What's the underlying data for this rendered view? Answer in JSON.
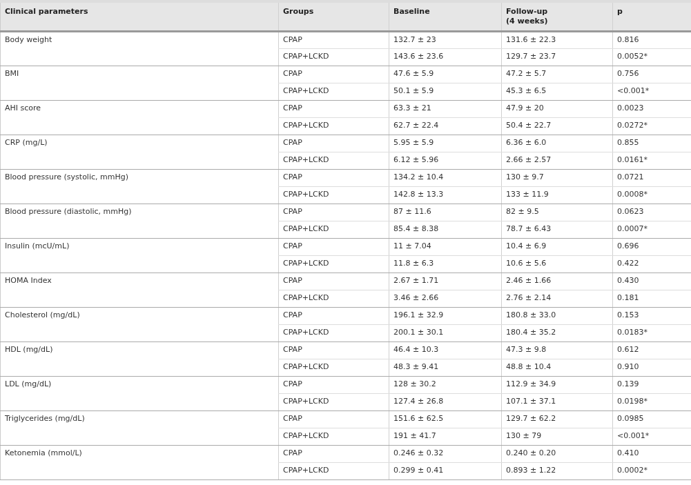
{
  "table": {
    "columns": [
      "Clinical parameters",
      "Groups",
      "Baseline",
      "Follow-up\n(4 weeks)",
      "p"
    ],
    "rows": [
      {
        "parameter": "Body weight",
        "groups": [
          {
            "group": "CPAP",
            "baseline": "132.7 ± 23",
            "follow_up": "131.6 ± 22.3",
            "p": "0.816"
          },
          {
            "group": "CPAP+LCKD",
            "baseline": "143.6 ± 23.6",
            "follow_up": "129.7 ± 23.7",
            "p": "0.0052*"
          }
        ]
      },
      {
        "parameter": "BMI",
        "groups": [
          {
            "group": "CPAP",
            "baseline": "47.6 ± 5.9",
            "follow_up": "47.2 ± 5.7",
            "p": "0.756"
          },
          {
            "group": "CPAP+LCKD",
            "baseline": "50.1 ± 5.9",
            "follow_up": "45.3 ± 6.5",
            "p": "<0.001*"
          }
        ]
      },
      {
        "parameter": "AHI score",
        "groups": [
          {
            "group": "CPAP",
            "baseline": "63.3 ± 21",
            "follow_up": "47.9 ± 20",
            "p": "0.0023"
          },
          {
            "group": "CPAP+LCKD",
            "baseline": "62.7 ± 22.4",
            "follow_up": "50.4 ± 22.7",
            "p": "0.0272*"
          }
        ]
      },
      {
        "parameter": "CRP (mg/L)",
        "groups": [
          {
            "group": "CPAP",
            "baseline": "5.95 ± 5.9",
            "follow_up": "6.36 ± 6.0",
            "p": "0.855"
          },
          {
            "group": "CPAP+LCKD",
            "baseline": "6.12 ± 5.96",
            "follow_up": "2.66 ± 2.57",
            "p": "0.0161*"
          }
        ]
      },
      {
        "parameter": "Blood pressure (systolic, mmHg)",
        "groups": [
          {
            "group": "CPAP",
            "baseline": "134.2 ± 10.4",
            "follow_up": "130 ± 9.7",
            "p": "0.0721"
          },
          {
            "group": "CPAP+LCKD",
            "baseline": "142.8 ± 13.3",
            "follow_up": "133 ± 11.9",
            "p": "0.0008*"
          }
        ]
      },
      {
        "parameter": "Blood pressure (diastolic, mmHg)",
        "groups": [
          {
            "group": "CPAP",
            "baseline": "87 ± 11.6",
            "follow_up": "82 ± 9.5",
            "p": "0.0623"
          },
          {
            "group": "CPAP+LCKD",
            "baseline": "85.4 ± 8.38",
            "follow_up": "78.7 ± 6.43",
            "p": "0.0007*"
          }
        ]
      },
      {
        "parameter": "Insulin (mcU/mL)",
        "groups": [
          {
            "group": "CPAP",
            "baseline": "11 ± 7.04",
            "follow_up": "10.4 ± 6.9",
            "p": "0.696"
          },
          {
            "group": "CPAP+LCKD",
            "baseline": "11.8 ± 6.3",
            "follow_up": "10.6 ± 5.6",
            "p": "0.422"
          }
        ]
      },
      {
        "parameter": "HOMA Index",
        "groups": [
          {
            "group": "CPAP",
            "baseline": "2.67 ± 1.71",
            "follow_up": "2.46 ± 1.66",
            "p": "0.430"
          },
          {
            "group": "CPAP+LCKD",
            "baseline": "3.46 ± 2.66",
            "follow_up": "2.76 ± 2.14",
            "p": "0.181"
          }
        ]
      },
      {
        "parameter": "Cholesterol (mg/dL)",
        "groups": [
          {
            "group": "CPAP",
            "baseline": "196.1 ± 32.9",
            "follow_up": "180.8 ± 33.0",
            "p": "0.153"
          },
          {
            "group": "CPAP+LCKD",
            "baseline": "200.1 ± 30.1",
            "follow_up": "180.4 ± 35.2",
            "p": "0.0183*"
          }
        ]
      },
      {
        "parameter": "HDL (mg/dL)",
        "groups": [
          {
            "group": "CPAP",
            "baseline": "46.4 ± 10.3",
            "follow_up": "47.3 ± 9.8",
            "p": "0.612"
          },
          {
            "group": "CPAP+LCKD",
            "baseline": "48.3 ± 9.41",
            "follow_up": "48.8 ± 10.4",
            "p": "0.910"
          }
        ]
      },
      {
        "parameter": "LDL (mg/dL)",
        "groups": [
          {
            "group": "CPAP",
            "baseline": "128 ± 30.2",
            "follow_up": "112.9 ± 34.9",
            "p": "0.139"
          },
          {
            "group": "CPAP+LCKD",
            "baseline": "127.4 ± 26.8",
            "follow_up": "107.1 ± 37.1",
            "p": "0.0198*"
          }
        ]
      },
      {
        "parameter": "Triglycerides (mg/dL)",
        "groups": [
          {
            "group": "CPAP",
            "baseline": "151.6 ± 62.5",
            "follow_up": "129.7 ± 62.2",
            "p": "0.0985"
          },
          {
            "group": "CPAP+LCKD",
            "baseline": "191 ± 41.7",
            "follow_up": "130 ± 79",
            "p": "<0.001*"
          }
        ]
      },
      {
        "parameter": "Ketonemia (mmol/L)",
        "groups": [
          {
            "group": "CPAP",
            "baseline": "0.246 ± 0.32",
            "follow_up": "0.240 ± 0.20",
            "p": "0.410"
          },
          {
            "group": "CPAP+LCKD",
            "baseline": "0.299 ± 0.41",
            "follow_up": "0.893 ± 1.22",
            "p": "0.0002*"
          }
        ]
      }
    ]
  }
}
